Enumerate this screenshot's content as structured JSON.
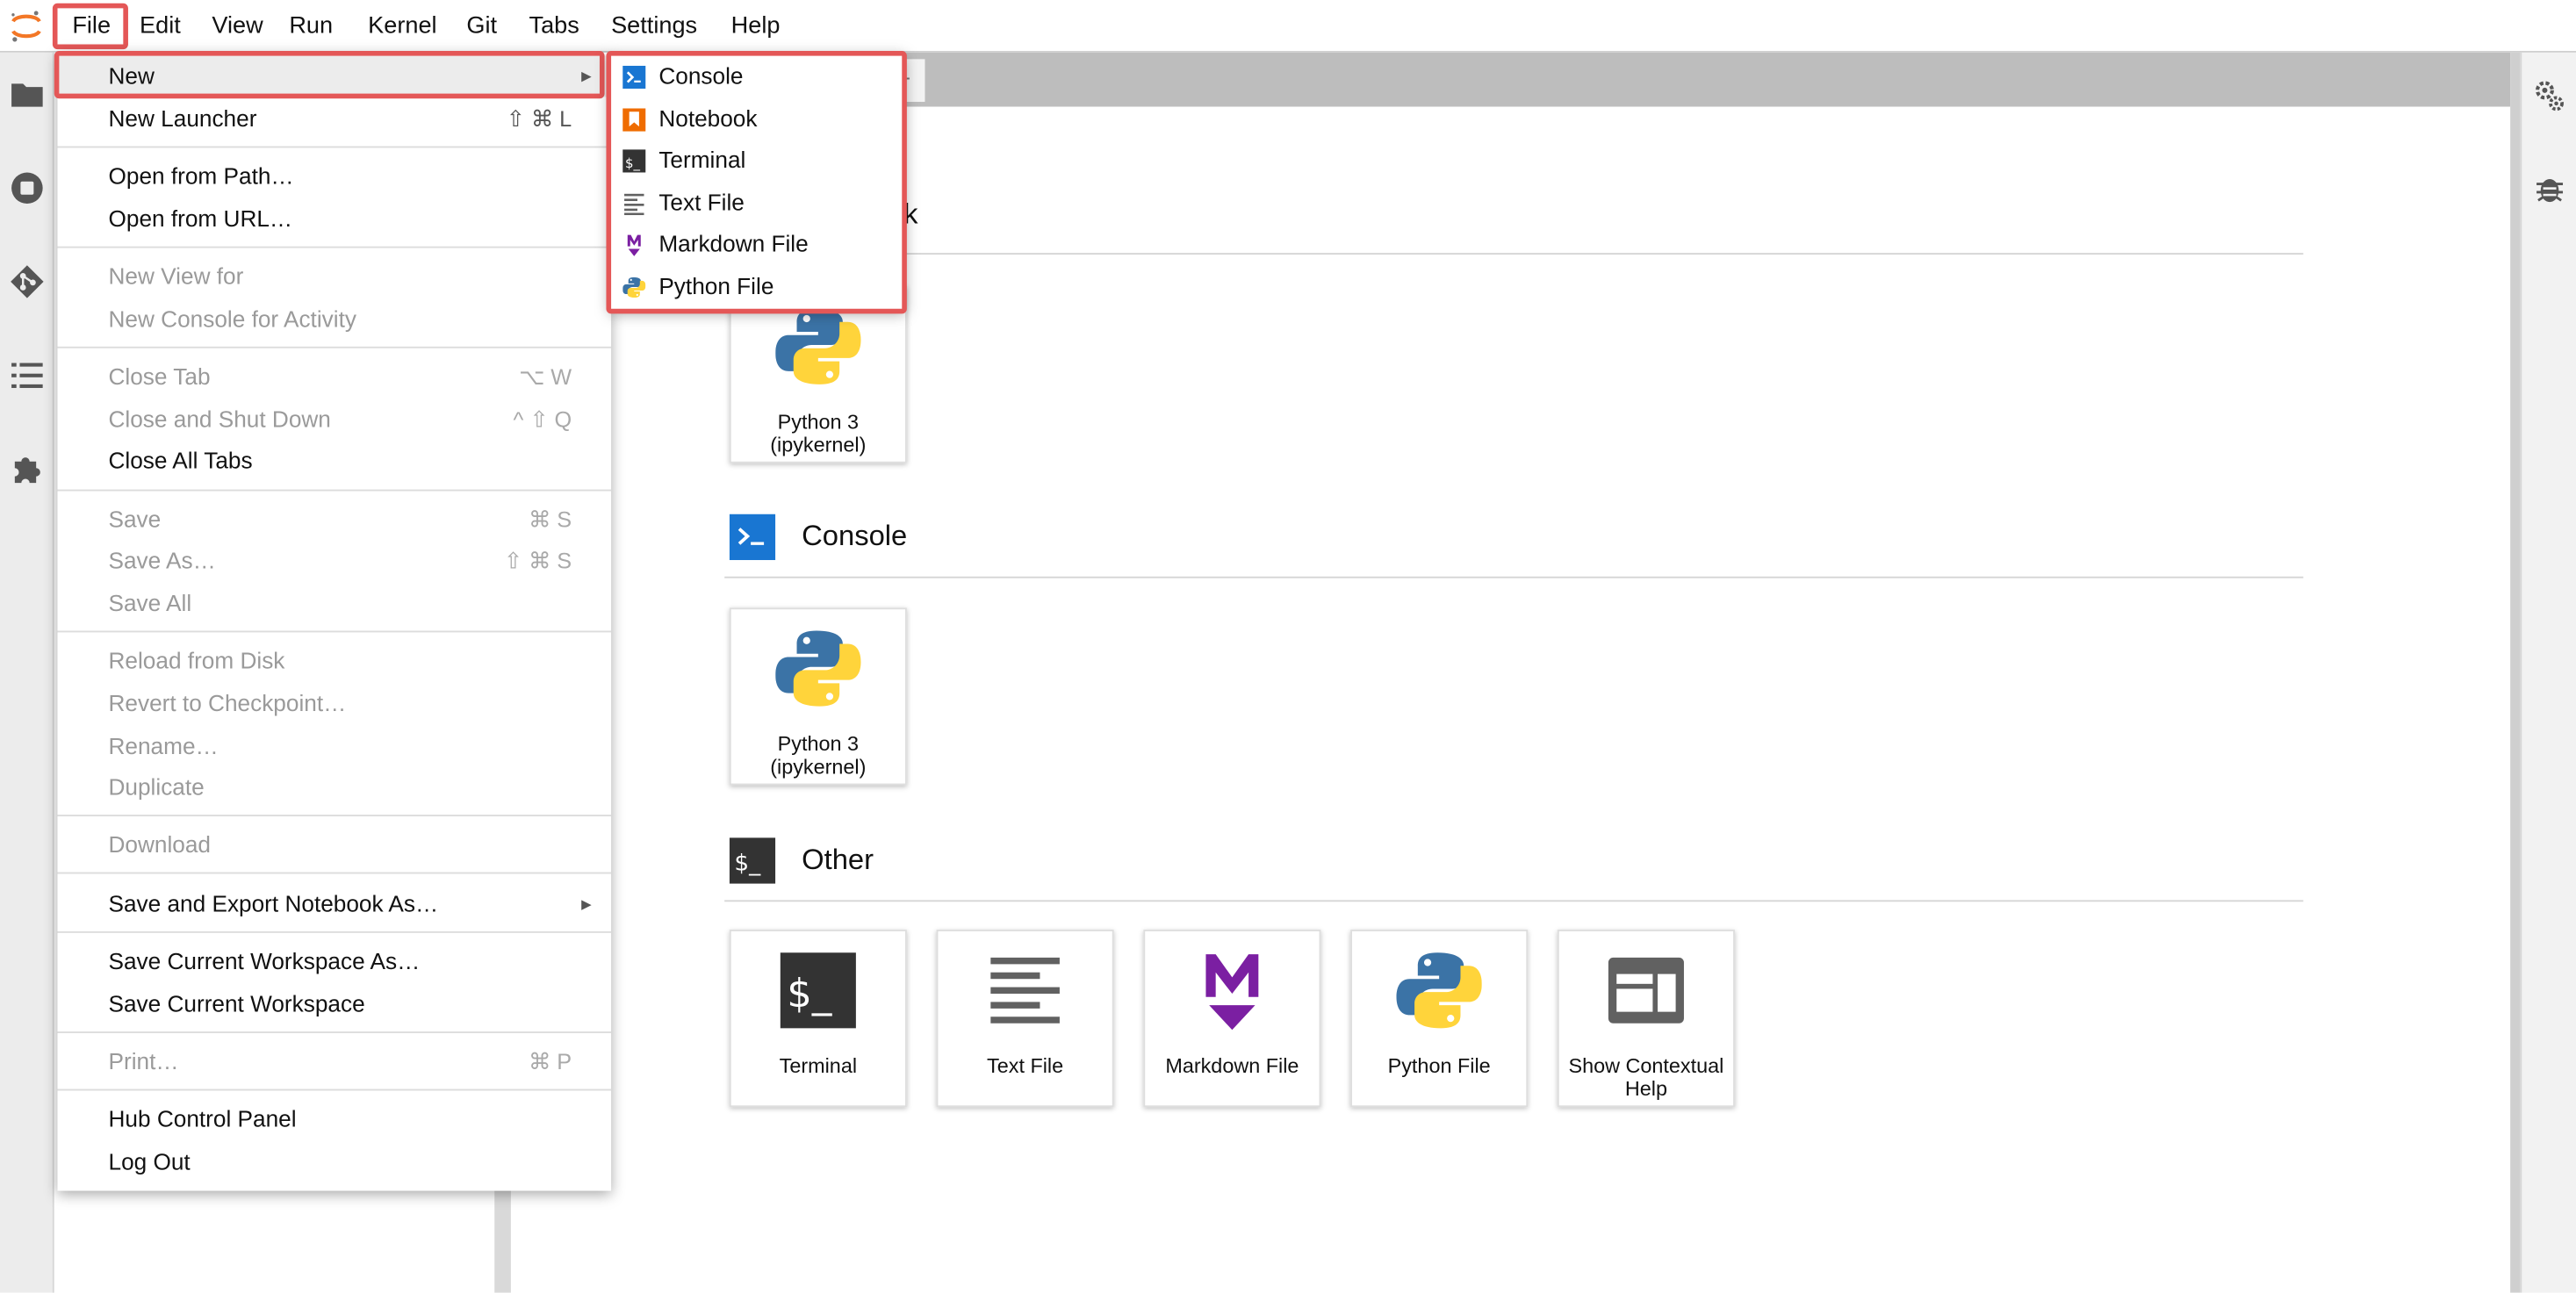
{
  "menubar": {
    "items": [
      "File",
      "Edit",
      "View",
      "Run",
      "Kernel",
      "Git",
      "Tabs",
      "Settings",
      "Help"
    ]
  },
  "launcher": {
    "notebook_section_fragment": "k",
    "sections": [
      {
        "title": "Console"
      },
      {
        "title": "Other"
      }
    ],
    "notebook_cards": [
      {
        "label": "Python 3 (ipykernel)"
      }
    ],
    "console_cards": [
      {
        "label": "Python 3 (ipykernel)"
      }
    ],
    "other_cards": [
      {
        "label": "Terminal"
      },
      {
        "label": "Text File"
      },
      {
        "label": "Markdown File"
      },
      {
        "label": "Python File"
      },
      {
        "label": "Show Contextual Help"
      }
    ],
    "tab_add": "+"
  },
  "file_menu": {
    "items": [
      {
        "label": "New",
        "shortcut": "",
        "disabled": false
      },
      {
        "label": "New Launcher",
        "shortcut": "⇧ ⌘ L",
        "disabled": false
      },
      {
        "label": "Open from Path…",
        "shortcut": "",
        "disabled": false
      },
      {
        "label": "Open from URL…",
        "shortcut": "",
        "disabled": false
      },
      {
        "label": "New View for",
        "shortcut": "",
        "disabled": true
      },
      {
        "label": "New Console for Activity",
        "shortcut": "",
        "disabled": true
      },
      {
        "label": "Close Tab",
        "shortcut": "⌥ W",
        "disabled": true
      },
      {
        "label": "Close and Shut Down",
        "shortcut": "^ ⇧ Q",
        "disabled": true
      },
      {
        "label": "Close All Tabs",
        "shortcut": "",
        "disabled": false
      },
      {
        "label": "Save",
        "shortcut": "⌘ S",
        "disabled": true
      },
      {
        "label": "Save As…",
        "shortcut": "⇧ ⌘ S",
        "disabled": true
      },
      {
        "label": "Save All",
        "shortcut": "",
        "disabled": true
      },
      {
        "label": "Reload from Disk",
        "shortcut": "",
        "disabled": true
      },
      {
        "label": "Revert to Checkpoint…",
        "shortcut": "",
        "disabled": true
      },
      {
        "label": "Rename…",
        "shortcut": "",
        "disabled": true
      },
      {
        "label": "Duplicate",
        "shortcut": "",
        "disabled": true
      },
      {
        "label": "Download",
        "shortcut": "",
        "disabled": true
      },
      {
        "label": "Save and Export Notebook As…",
        "shortcut": "",
        "disabled": false
      },
      {
        "label": "Save Current Workspace As…",
        "shortcut": "",
        "disabled": false
      },
      {
        "label": "Save Current Workspace",
        "shortcut": "",
        "disabled": false
      },
      {
        "label": "Print…",
        "shortcut": "⌘ P",
        "disabled": true
      },
      {
        "label": "Hub Control Panel",
        "shortcut": "",
        "disabled": false
      },
      {
        "label": "Log Out",
        "shortcut": "",
        "disabled": false
      }
    ]
  },
  "new_submenu": {
    "items": [
      {
        "label": "Console",
        "icon": "console-icon"
      },
      {
        "label": "Notebook",
        "icon": "notebook-icon"
      },
      {
        "label": "Terminal",
        "icon": "terminal-icon"
      },
      {
        "label": "Text File",
        "icon": "text-file-icon"
      },
      {
        "label": "Markdown File",
        "icon": "markdown-icon"
      },
      {
        "label": "Python File",
        "icon": "python-icon"
      }
    ]
  },
  "colors": {
    "highlight_border": "#e45757",
    "console_blue": "#1976d2",
    "notebook_orange": "#ef6c00",
    "markdown_purple": "#7b1fa2",
    "terminal_dark": "#333333"
  }
}
